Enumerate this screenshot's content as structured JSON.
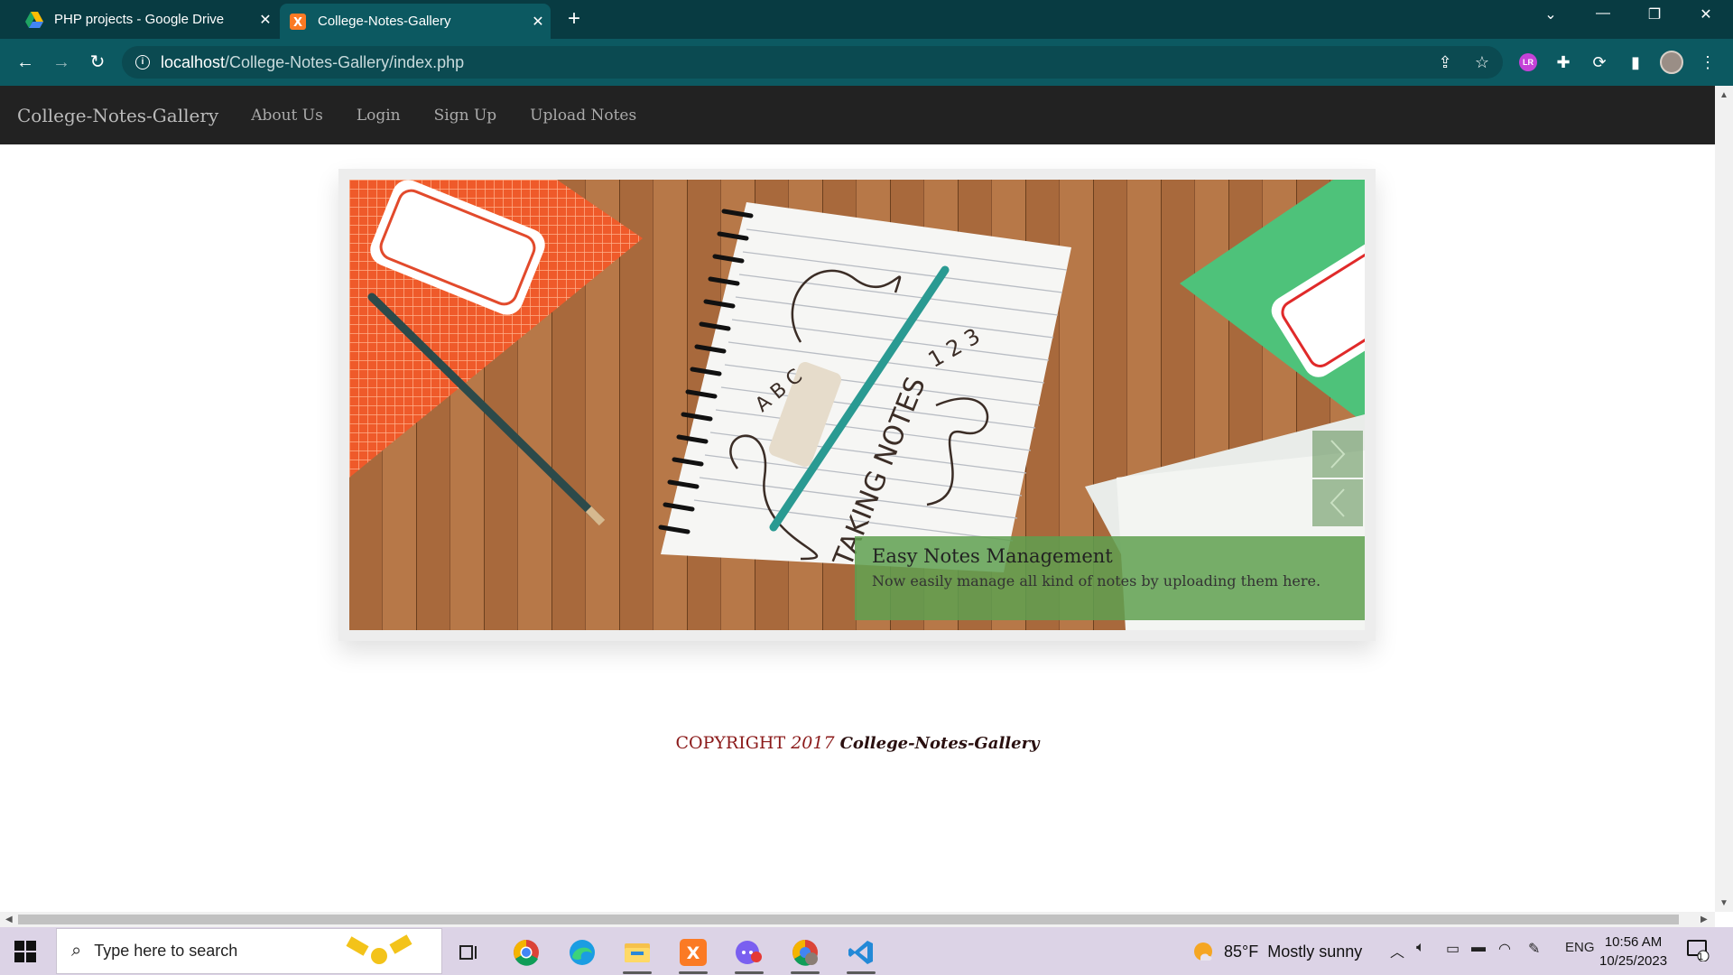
{
  "browser": {
    "tabs": [
      {
        "title": "PHP projects - Google Drive",
        "active": false
      },
      {
        "title": "College-Notes-Gallery",
        "active": true
      }
    ],
    "url_host": "localhost",
    "url_path": "/College-Notes-Gallery/index.php",
    "profile_badge": "LR"
  },
  "page": {
    "navbar": {
      "brand": "College-Notes-Gallery",
      "links": [
        "About Us",
        "Login",
        "Sign Up",
        "Upload Notes"
      ]
    },
    "slider": {
      "caption_title": "Easy Notes Management",
      "caption_text": "Now easily manage all kind of notes by uploading them here.",
      "image_text": {
        "main": "TAKING NOTES",
        "abc": "A B C",
        "nums": "1 2 3"
      }
    },
    "footer": {
      "copyright_word": "COPYRIGHT",
      "year": "2017",
      "site_name": "College-Notes-Gallery"
    }
  },
  "taskbar": {
    "search_placeholder": "Type here to search",
    "weather_temp": "85°F",
    "weather_text": "Mostly sunny",
    "language": "ENG",
    "time": "10:56 AM",
    "date": "10/25/2023",
    "notification_count": "1"
  },
  "colors": {
    "tabstrip": "#083b42",
    "toolbar": "#0c5961",
    "navbar": "#222222",
    "caption_bg": "#5fa050",
    "copyright_red": "#8b1a1a"
  }
}
